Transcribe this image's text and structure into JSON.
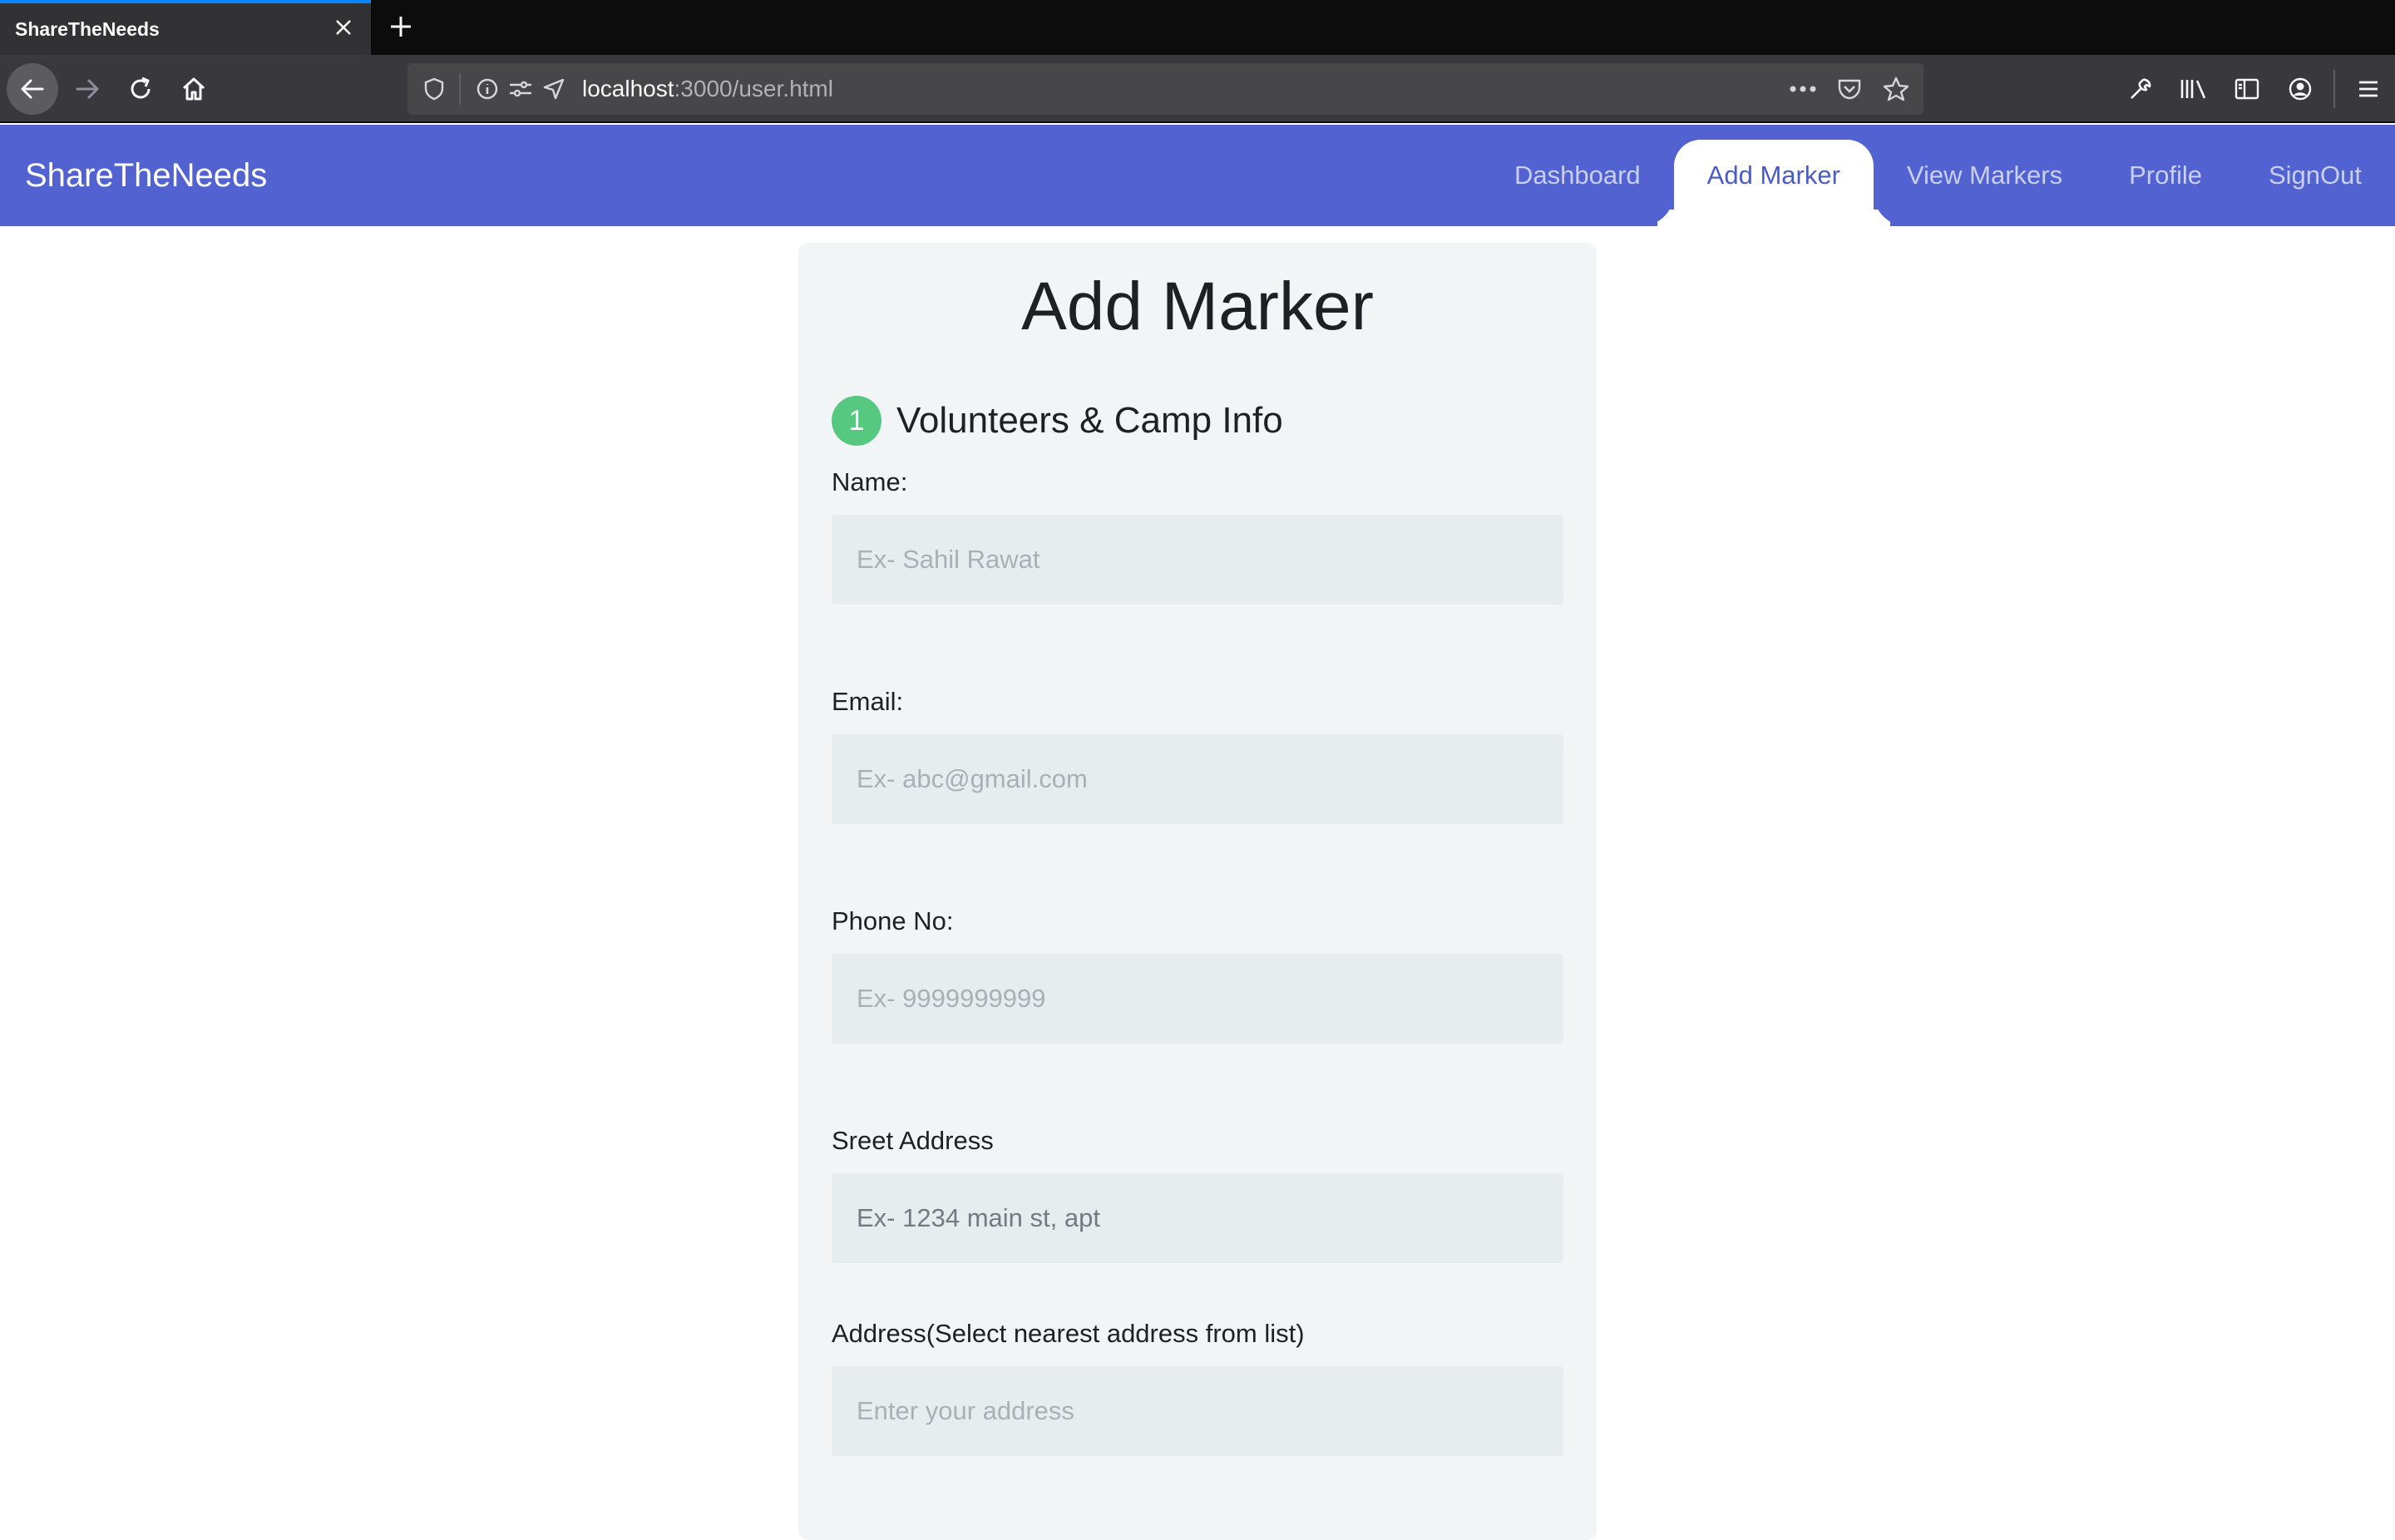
{
  "browser": {
    "tab_title": "ShareTheNeeds",
    "url_host": "localhost",
    "url_rest": ":3000/user.html"
  },
  "app": {
    "brand": "ShareTheNeeds",
    "nav": [
      {
        "label": "Dashboard",
        "active": false
      },
      {
        "label": "Add Marker",
        "active": true
      },
      {
        "label": "View Markers",
        "active": false
      },
      {
        "label": "Profile",
        "active": false
      },
      {
        "label": "SignOut",
        "active": false
      }
    ]
  },
  "form": {
    "title": "Add Marker",
    "step_number": "1",
    "section_title": "Volunteers & Camp Info",
    "fields": {
      "name": {
        "label": "Name:",
        "placeholder": "Ex- Sahil Rawat"
      },
      "email": {
        "label": "Email:",
        "placeholder": "Ex- abc@gmail.com"
      },
      "phone": {
        "label": "Phone No:",
        "placeholder": "Ex- 9999999999"
      },
      "street": {
        "label": "Sreet Address",
        "placeholder": "Ex- 1234 main st, apt"
      },
      "address": {
        "label": "Address(Select nearest address from list)",
        "placeholder": "Enter your address"
      }
    }
  },
  "colors": {
    "header_bg": "#5263d1",
    "step_badge": "#56c880",
    "card_bg": "#f1f5f6",
    "input_bg": "#e7ecef"
  }
}
